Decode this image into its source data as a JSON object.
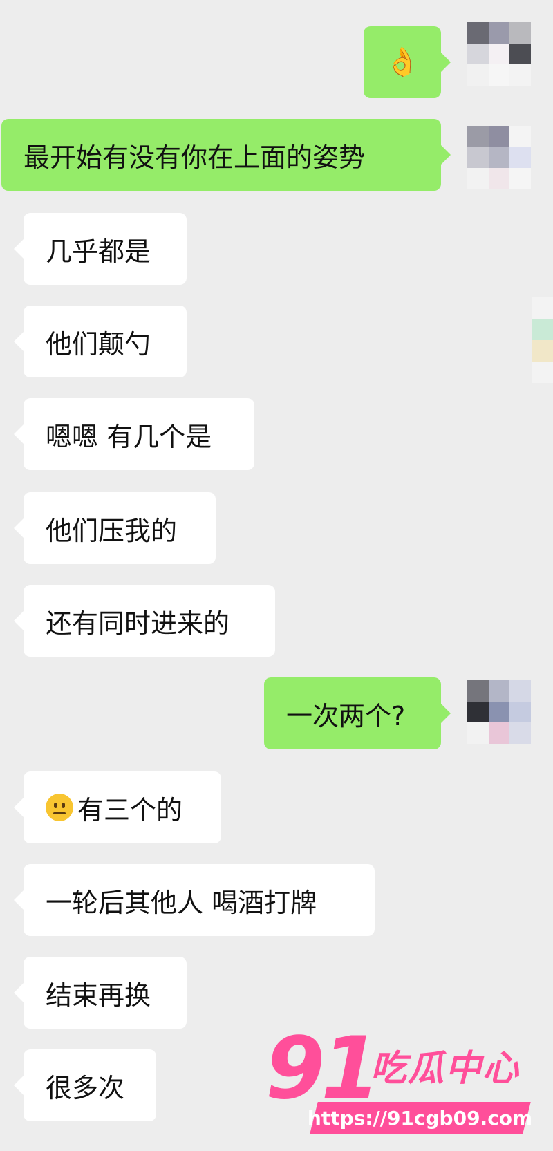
{
  "messages": [
    {
      "side": "out",
      "text": "👌",
      "kind": "ok"
    },
    {
      "side": "out",
      "text": "最开始有没有你在上面的姿势"
    },
    {
      "side": "in",
      "text": "几乎都是"
    },
    {
      "side": "in",
      "text": "他们颠勺"
    },
    {
      "side": "in",
      "text": "嗯嗯 有几个是"
    },
    {
      "side": "in",
      "text": "他们压我的"
    },
    {
      "side": "in",
      "text": "还有同时进来的"
    },
    {
      "side": "out",
      "text": "一次两个?"
    },
    {
      "side": "in",
      "text": "有三个的",
      "emoji": "neutral-face"
    },
    {
      "side": "in",
      "text": "一轮后其他人 喝酒打牌"
    },
    {
      "side": "in",
      "text": "结束再换"
    },
    {
      "side": "in",
      "text": "很多次"
    }
  ],
  "watermark": {
    "number": "91",
    "name": "吃瓜中心",
    "url": "https://91cgb09.com"
  },
  "colors": {
    "background": "#ededed",
    "incoming_bubble": "#ffffff",
    "outgoing_bubble": "#95ec69",
    "watermark": "#ff4f9a"
  },
  "icons": {
    "ok_hand": "ok-hand-emoji",
    "neutral": "neutral-face-emoji",
    "avatar": "pixelated-avatar"
  }
}
